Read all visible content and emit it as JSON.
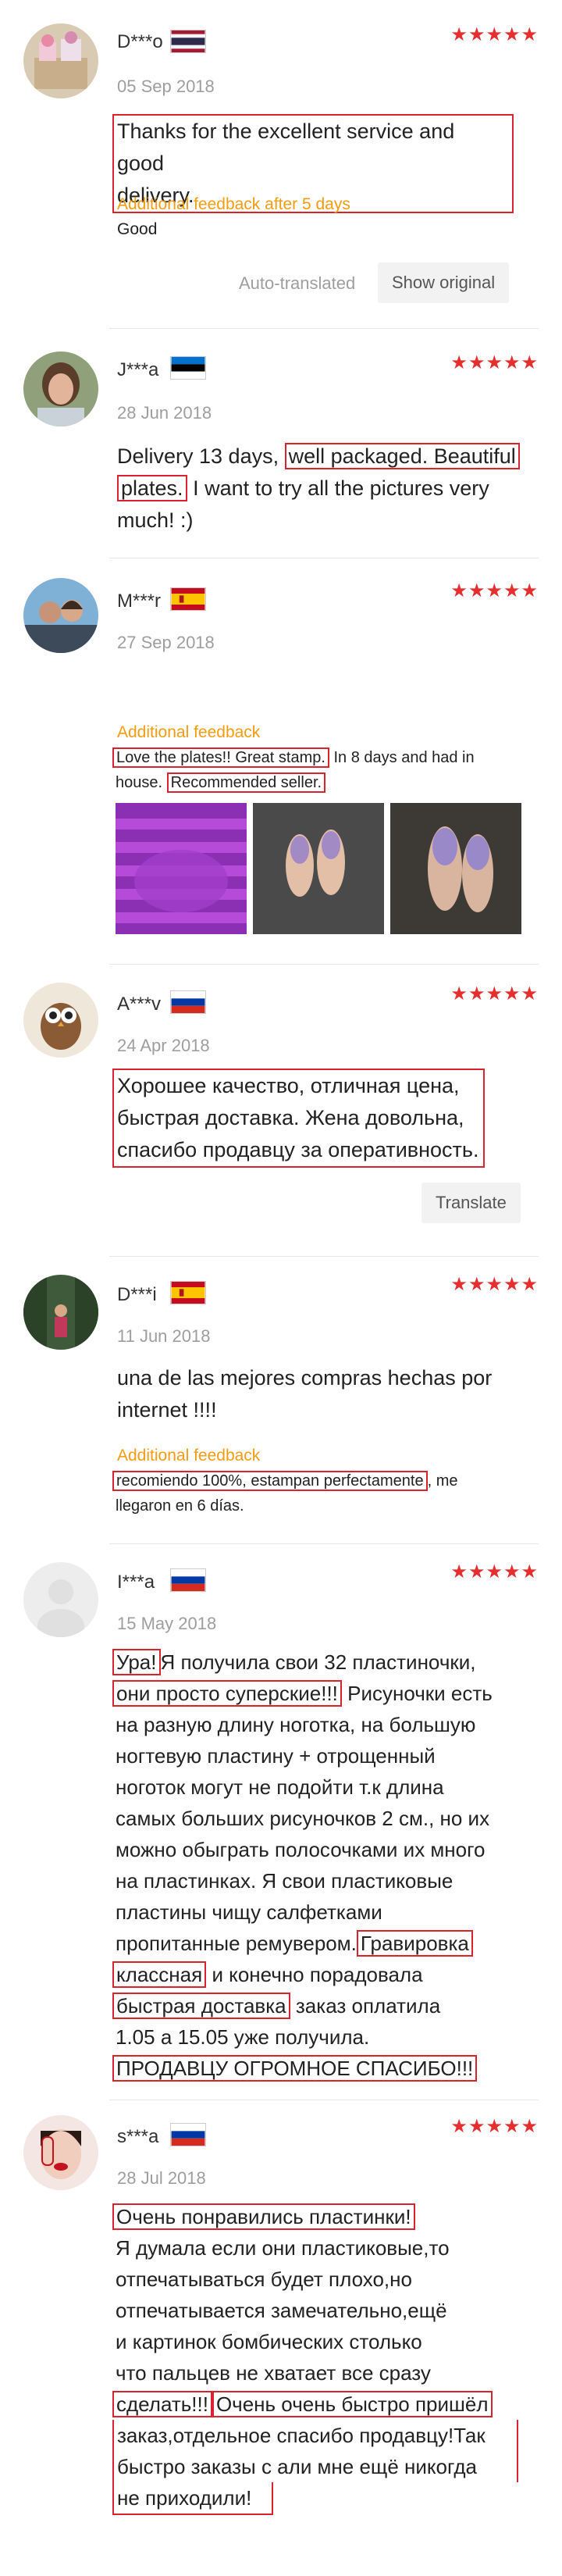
{
  "reviews": [
    {
      "name": "D***o",
      "flag": "thailand-flag",
      "stars": "★★★★★",
      "date": "05 Sep 2018",
      "text_1": "Thanks for the excellent service and good",
      "text_2": "delivery.",
      "feedback_label": "Additional feedback after 5 days",
      "feedback_text": "Good",
      "auto_translated": "Auto-translated",
      "show_original": "Show original"
    },
    {
      "name": "J***a",
      "flag": "estonia-flag",
      "stars": "★★★★★",
      "date": "28 Jun 2018",
      "text_1_plain": "Delivery 13 days,",
      "text_1_hl": "well packaged. Beautiful",
      "text_2_hl": "plates.",
      "text_2_plain": "I want to try all the pictures very",
      "text_3": "much! :)"
    },
    {
      "name": "M***r",
      "flag": "spain-flag",
      "stars": "★★★★★",
      "date": "27 Sep 2018",
      "feedback_label": "Additional feedback",
      "fb_1_hl": "Love the plates!! Great stamp.",
      "fb_1_plain": "In 8 days and had in",
      "fb_2_plain": "house.",
      "fb_2_hl": "Recommended seller."
    },
    {
      "name": "A***v",
      "flag": "russia-flag",
      "stars": "★★★★★",
      "date": "24 Apr 2018",
      "text_1": "Хорошее качество, отличная цена,",
      "text_2": "быстрая доставка. Жена довольна,",
      "text_3": "спасибо продавцу за оперативность.",
      "translate": "Translate"
    },
    {
      "name": "D***i",
      "flag": "spain-flag",
      "stars": "★★★★★",
      "date": "11 Jun 2018",
      "text_1": "una de las mejores compras hechas por",
      "text_2": "internet !!!!",
      "feedback_label": "Additional feedback",
      "fb_1_hl": "recomiendo 100%, estampan perfectamente",
      "fb_1_plain": ", me",
      "fb_2": "llegaron en 6 días."
    },
    {
      "name": "I***a",
      "flag": "russia-flag",
      "stars": "★★★★★",
      "date": "15 May 2018",
      "l1_hl": "Ура!",
      "l1_plain": "Я получила свои 32 пластиночки,",
      "l2_hl": "они просто суперские!!!",
      "l2_plain": "Рисуночки есть",
      "l3": "на разную длину ноготка, на большую",
      "l4": "ногтевую пластину + отрощенный",
      "l5": "ноготок  могут не подойти  т.к  длина",
      "l6": "самых больших  рисуночков 2 см., но их",
      "l7": "можно обыграть полосочками их много",
      "l8": "на пластинках. Я свои пластиковые",
      "l9": "пластины чищу  салфетками",
      "l10_plain": "пропитанные ремувером.",
      "l10_hl": "Гравировка",
      "l11_hl": "классная",
      "l11_plain": "и конечно порадовала",
      "l12_hl": "быстрая доставка",
      "l12_plain": "заказ оплатила",
      "l13": "1.05 а 15.05 уже получила.",
      "l14_hl": "ПРОДАВЦУ  ОГРОМНОЕ СПАСИБО!!!"
    },
    {
      "name": "s***a",
      "flag": "russia-flag",
      "stars": "★★★★★",
      "date": "28 Jul 2018",
      "l1_hl": "Очень понравились пластинки!",
      "l2": "Я думала если они пластиковые,то",
      "l3": "отпечатываться будет плохо,но",
      "l4": "отпечатывается замечательно,ещё",
      "l5": "и картинок бомбических столько",
      "l6": "что пальцев не хватает все сразу",
      "l7_hl": "сделать!!!",
      "l7_hl2": "Очень очень быстро пришёл",
      "l8": "заказ,отдельное спасибо продавцу!Так",
      "l9": "быстро заказы с али мне ещё никогда",
      "l10": "не приходили!"
    }
  ]
}
